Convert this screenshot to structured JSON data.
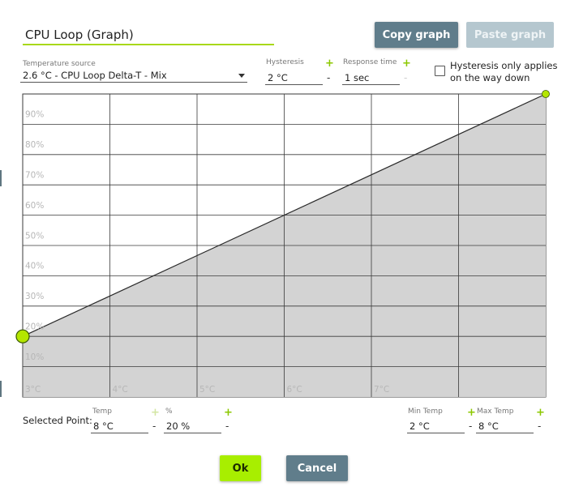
{
  "dialog": {
    "title_value": "CPU Loop (Graph)",
    "copy_label": "Copy graph",
    "paste_label": "Paste graph",
    "ok_label": "Ok",
    "cancel_label": "Cancel"
  },
  "settings": {
    "temp_source_label": "Temperature source",
    "temp_source_value": "2.6 °C - CPU Loop Delta-T - Mix",
    "hysteresis_label": "Hysteresis",
    "hysteresis_value": "2 °C",
    "response_label": "Response time",
    "response_value": "1 sec",
    "hysteresis_down_line1": "Hysteresis only applies",
    "hysteresis_down_line2": "on the way down",
    "hysteresis_down_checked": false
  },
  "selected_point": {
    "label": "Selected Point:",
    "temp_label": "Temp",
    "temp_value": "8 °C",
    "pct_label": "%",
    "pct_value": "20 %",
    "min_temp_label": "Min Temp",
    "min_temp_value": "2 °C",
    "max_temp_label": "Max Temp",
    "max_temp_value": "8 °C"
  },
  "symbols": {
    "plus": "+",
    "minus": "-"
  },
  "icons": {
    "dropdown": "caret-down-icon",
    "checkbox": "checkbox-icon"
  },
  "colors": {
    "accent": "#a8d81a",
    "button_dark": "#607d8b",
    "button_disabled": "#b5c7cf",
    "ok_button": "#a8ee00",
    "graph_fill": "#d3d3d3",
    "point": "#b4e600"
  },
  "chart_data": {
    "type": "area",
    "x_ticks": [
      {
        "value": 3,
        "label": "3°C"
      },
      {
        "value": 4,
        "label": "4°C"
      },
      {
        "value": 5,
        "label": "5°C"
      },
      {
        "value": 6,
        "label": "6°C"
      },
      {
        "value": 7,
        "label": "7°C"
      }
    ],
    "y_ticks": [
      {
        "value": 10,
        "label": "10%"
      },
      {
        "value": 20,
        "label": "20%"
      },
      {
        "value": 30,
        "label": "30%"
      },
      {
        "value": 40,
        "label": "40%"
      },
      {
        "value": 50,
        "label": "50%"
      },
      {
        "value": 60,
        "label": "60%"
      },
      {
        "value": 70,
        "label": "70%"
      },
      {
        "value": 80,
        "label": "80%"
      },
      {
        "value": 90,
        "label": "90%"
      }
    ],
    "xlim": [
      2,
      8
    ],
    "ylim": [
      0,
      100
    ],
    "grid": true,
    "points": [
      {
        "x": 2,
        "y": 20
      },
      {
        "x": 8,
        "y": 100
      }
    ]
  }
}
